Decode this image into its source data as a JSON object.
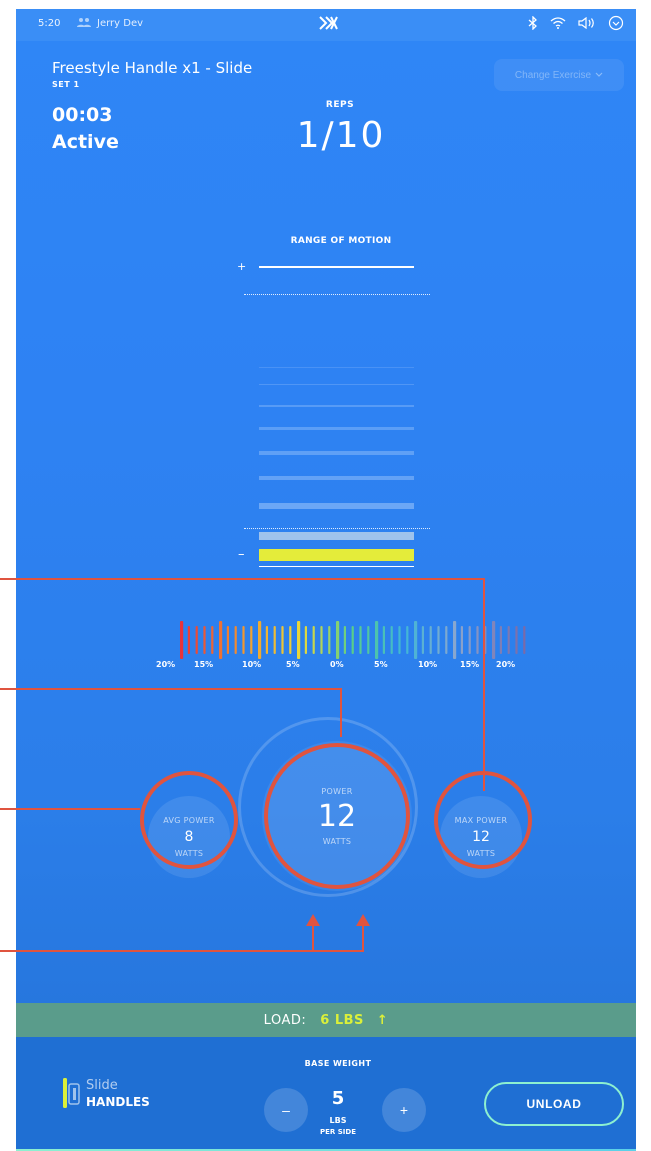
{
  "status_bar": {
    "time": "5:20",
    "user": "Jerry Dev"
  },
  "exercise": {
    "title": "Freestyle Handle x1 - Slide",
    "set": "SET 1",
    "change_label": "Change Exercise"
  },
  "timer": "00:03",
  "state": "Active",
  "reps": {
    "label": "REPS",
    "value": "1/10"
  },
  "range_of_motion": {
    "label": "RANGE OF MOTION",
    "plus": "+",
    "minus": "–"
  },
  "balance": {
    "labels": [
      "20%",
      "15%",
      "10%",
      "5%",
      "0%",
      "5%",
      "10%",
      "15%",
      "20%"
    ]
  },
  "power": {
    "label": "POWER",
    "value": "12",
    "unit": "WATTS"
  },
  "avg_power": {
    "label": "AVG POWER",
    "value": "8",
    "unit": "WATTS"
  },
  "max_power": {
    "label": "MAX POWER",
    "value": "12",
    "unit": "WATTS"
  },
  "load": {
    "label": "LOAD:",
    "value": "6 LBS",
    "arrow": "↑"
  },
  "attachment": {
    "mode": "Slide",
    "name": "HANDLES"
  },
  "base_weight": {
    "label": "BASE WEIGHT",
    "value": "5",
    "unit": "LBS",
    "per": "PER SIDE",
    "minus": "–",
    "plus": "+"
  },
  "unload_label": "UNLOAD",
  "colors": {
    "accent_yellow": "#e4ec3a",
    "annotation_red": "#e0543f",
    "load_bar": "#5a9c8b",
    "unload_border": "#8df0d0"
  }
}
